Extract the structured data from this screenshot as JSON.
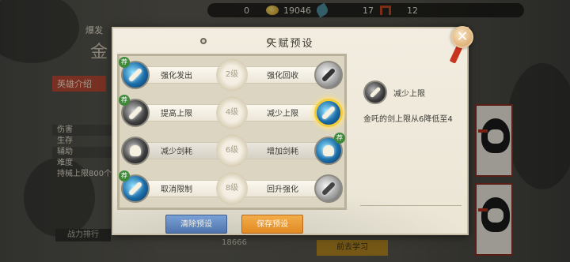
{
  "topbar": {
    "v1": "0",
    "v2": "19046",
    "v3": "17",
    "v4": "12"
  },
  "hero": {
    "top_label": "爆发",
    "name": "金",
    "intro_tab": "英雄介绍",
    "stats": [
      "伤害",
      "生存",
      "辅助",
      "难度"
    ],
    "limit_text": "持械上限800个",
    "rank_button": "战力排行"
  },
  "bottom": {
    "resources": "18666",
    "study_button": "前去学习"
  },
  "dialog": {
    "title": "天赋预设",
    "close_symbol": "✕",
    "jian_mark": "荐",
    "rows": [
      {
        "left_label": "强化发出",
        "level": "2级",
        "right_label": "强化回收"
      },
      {
        "left_label": "提高上限",
        "level": "4级",
        "right_label": "减少上限"
      },
      {
        "left_label": "减少剑耗",
        "level": "6级",
        "right_label": "增加剑耗"
      },
      {
        "left_label": "取消限制",
        "level": "8级",
        "right_label": "回升强化"
      }
    ],
    "detail": {
      "name": "减少上限",
      "description": "金吒的剑上限从6降低至4"
    },
    "clear_button": "清除预设",
    "save_button": "保存预设"
  },
  "colors": {
    "dialog_bg": "#f2ede0",
    "selected_ring": "#f2cc3a",
    "clear_button": "#5b7fb8",
    "save_button": "#e8962e",
    "close_button": "#d59b5c"
  }
}
